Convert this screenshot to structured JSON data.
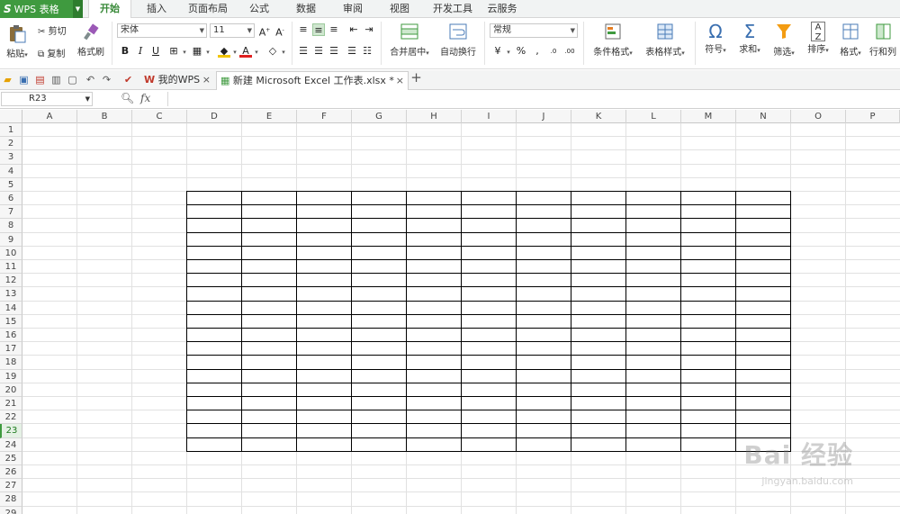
{
  "app": {
    "logo_letter": "S",
    "title": "WPS 表格",
    "menu_tabs": [
      "开始",
      "插入",
      "页面布局",
      "公式",
      "数据",
      "审阅",
      "视图",
      "开发工具",
      "云服务"
    ],
    "active_tab": "开始"
  },
  "ribbon": {
    "paste": "粘贴",
    "cut": "剪切",
    "copy": "复制",
    "format_painter": "格式刷",
    "font_name": "宋体",
    "font_size": "11",
    "merge_center": "合并居中",
    "wrap_text": "自动换行",
    "number_format": "常规",
    "conditional_format": "条件格式",
    "table_style": "表格样式",
    "symbol": "符号",
    "sum": "求和",
    "filter": "筛选",
    "sort": "排序",
    "format": "格式",
    "rows_cols": "行和列"
  },
  "doc_tabs": [
    {
      "label": "我的WPS",
      "close": "×"
    },
    {
      "label": "新建 Microsoft Excel 工作表.xlsx *",
      "close": "×"
    }
  ],
  "new_tab": "+",
  "formula_bar": {
    "cell_ref": "R23",
    "fx": "fx"
  },
  "columns": [
    "A",
    "B",
    "C",
    "D",
    "E",
    "F",
    "G",
    "H",
    "I",
    "J",
    "K",
    "L",
    "M",
    "N",
    "O",
    "P"
  ],
  "rows": [
    "1",
    "2",
    "3",
    "4",
    "5",
    "6",
    "7",
    "8",
    "9",
    "10",
    "11",
    "12",
    "13",
    "14",
    "15",
    "16",
    "17",
    "18",
    "19",
    "20",
    "21",
    "22",
    "23",
    "24",
    "25",
    "26",
    "27",
    "28",
    "29"
  ],
  "selected_row": "23",
  "bordered_range": "D6:N24",
  "watermark": {
    "main": "Bai 经验",
    "sub": "jingyan.baidu.com"
  },
  "colors": {
    "brand_green": "#3f9a3f",
    "active_tab_text": "#3a8a3a",
    "selected_row_header": "#e5f1e5"
  }
}
